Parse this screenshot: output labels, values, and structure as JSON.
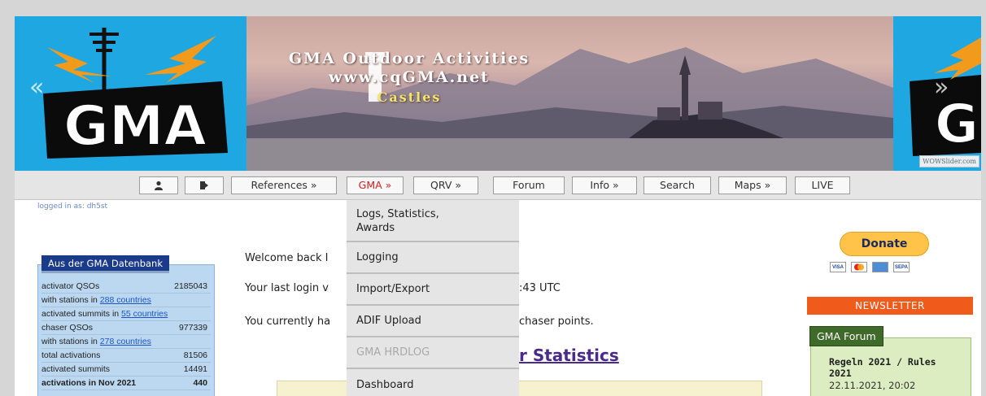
{
  "banner": {
    "line1": "GMA Outdoor Activities",
    "line2": "www.cqGMA.net",
    "line3": "Castles",
    "slider_credit": "WOWSlider.com",
    "left_logo_text": "GMA",
    "right_logo_text": "G",
    "prev_arrow": "«",
    "next_arrow": "»"
  },
  "nav": {
    "user_icon": "user-icon",
    "logout_icon": "logout-icon",
    "items": [
      {
        "label": "References »"
      },
      {
        "label": "GMA »"
      },
      {
        "label": "QRV »"
      },
      {
        "label": "Forum"
      },
      {
        "label": "Info »"
      },
      {
        "label": "Search"
      },
      {
        "label": "Maps »"
      },
      {
        "label": "LIVE"
      }
    ],
    "active_color": "#d42020"
  },
  "logged_in": "logged in as: dh5st",
  "dropdown": {
    "items": [
      {
        "label": "Logs, Statistics,\nAwards",
        "enabled": true
      },
      {
        "label": "Logging",
        "enabled": true
      },
      {
        "label": "Import/Export",
        "enabled": true
      },
      {
        "label": "ADIF Upload",
        "enabled": true
      },
      {
        "label": "GMA HRDLOG",
        "enabled": false
      },
      {
        "label": "Dashboard",
        "enabled": true
      }
    ]
  },
  "database_box": {
    "title": "Aus der GMA Datenbank",
    "rows": [
      {
        "label": "activator QSOs",
        "value": "2185043"
      },
      {
        "prefix": "with stations in ",
        "link": "288 countries"
      },
      {
        "prefix": "activated summits in ",
        "link": "55 countries"
      },
      {
        "label": "chaser QSOs",
        "value": "977339"
      },
      {
        "prefix": "with stations in ",
        "link": "278 countries"
      },
      {
        "label": "total activations",
        "value": "81506"
      },
      {
        "label": "activated summits",
        "value": "14491"
      },
      {
        "label": "activations in Nov 2021",
        "value": "440"
      }
    ]
  },
  "main": {
    "welcome": "Welcome back I",
    "last_login_a": "Your last login v",
    "last_login_b": ":43 UTC",
    "points_a": "You currently ha",
    "points_b": "chaser points.",
    "statistics_heading": "r Statistics"
  },
  "right": {
    "donate_label": "Donate",
    "cards": [
      "VISA",
      "",
      "",
      "SEPA"
    ],
    "newsletter": "NEWSLETTER",
    "forum": {
      "title": "GMA Forum",
      "post_title": "Regeln 2021 / Rules 2021",
      "post_date": "22.11.2021, 20:02"
    }
  }
}
